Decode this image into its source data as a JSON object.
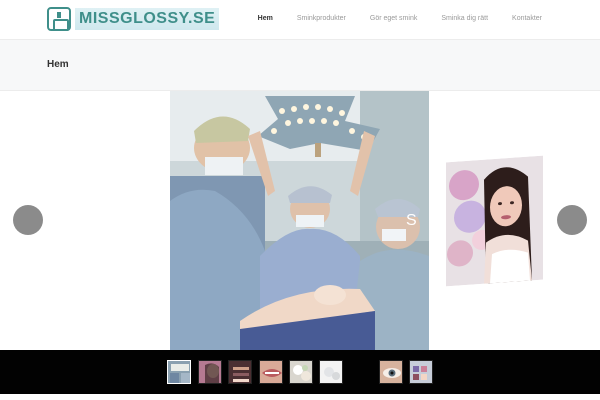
{
  "header": {
    "logo_text": "MISSGLOSSY.SE",
    "nav": [
      {
        "label": "Hem",
        "active": true
      },
      {
        "label": "Sminkprodukter",
        "active": false
      },
      {
        "label": "Gör eget smink",
        "active": false
      },
      {
        "label": "Sminka dig rätt",
        "active": false
      },
      {
        "label": "Kontakter",
        "active": false
      }
    ]
  },
  "page": {
    "title": "Hem"
  },
  "slider": {
    "main_slide_icon": "surgery-scene-photo",
    "side_slide_icon": "woman-portrait-photo"
  },
  "thumbnails": [
    {
      "icon": "surgery-thumb"
    },
    {
      "icon": "woman-face-thumb"
    },
    {
      "icon": "makeup-brushes-thumb"
    },
    {
      "icon": "lips-thumb"
    },
    {
      "icon": "flowers-thumb"
    },
    {
      "icon": "white-thumb"
    },
    {
      "icon": "eye-thumb"
    },
    {
      "icon": "palette-thumb"
    }
  ],
  "colors": {
    "brand": "#3f8f8a",
    "thumbbar": "#020202",
    "arrow": "#8b8b8b"
  }
}
